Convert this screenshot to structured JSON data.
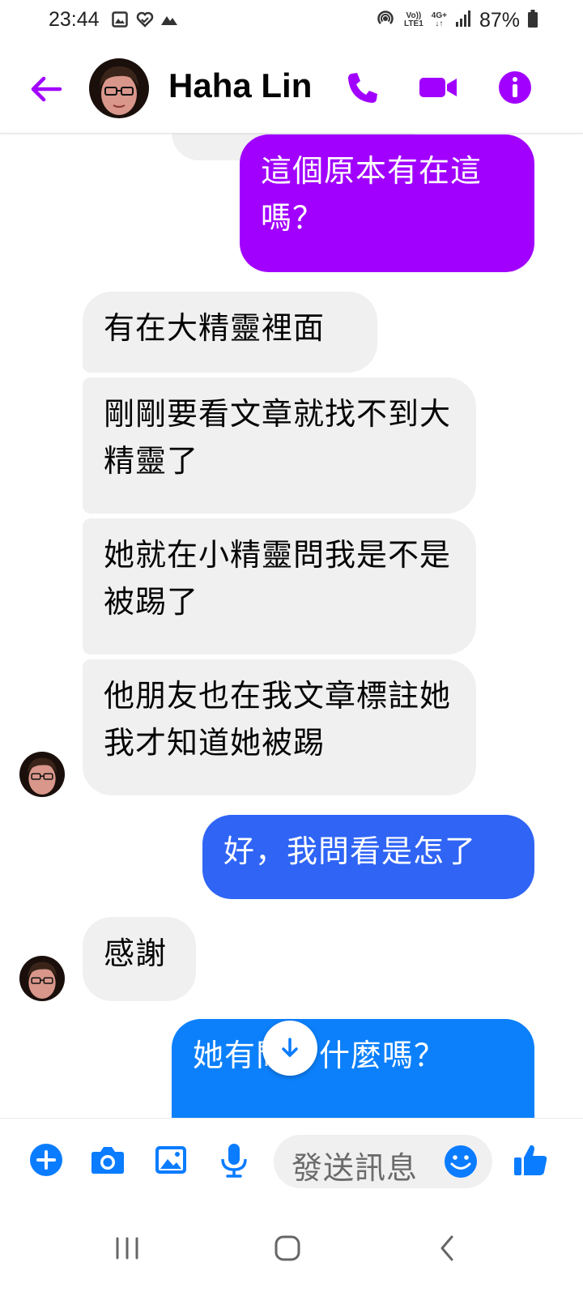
{
  "status_bar": {
    "time": "23:44",
    "battery": "87%",
    "volte": "Vo))",
    "lte": "LTE1",
    "network": "4G+",
    "left_icons": [
      "gallery-icon",
      "heart-check-icon",
      "mountain-icon"
    ],
    "right_icons": [
      "hotspot-icon",
      "signal-icon",
      "battery-icon"
    ]
  },
  "header": {
    "contact_name": "Haha Lin",
    "accent_color": "#a100ff"
  },
  "messages": [
    {
      "sender": "me",
      "text": "這個原本有在這嗎？",
      "color": "#a100ff"
    },
    {
      "sender": "contact",
      "text": "有在大精靈裡面"
    },
    {
      "sender": "contact",
      "text": "剛剛要看文章就找不到大精靈了"
    },
    {
      "sender": "contact",
      "text": "她就在小精靈問我是不是被踢了"
    },
    {
      "sender": "contact",
      "text": "他朋友也在我文章標註她我才知道她被踢"
    },
    {
      "sender": "me",
      "text": "好，我問看是怎了",
      "color": "#2f64f5"
    },
    {
      "sender": "contact",
      "text": "感謝"
    },
    {
      "sender": "me",
      "text": "她有問了什麼嗎？",
      "color": "#0c80fb"
    }
  ],
  "composer": {
    "placeholder": "發送訊息",
    "accent_color": "#0a7cff"
  }
}
